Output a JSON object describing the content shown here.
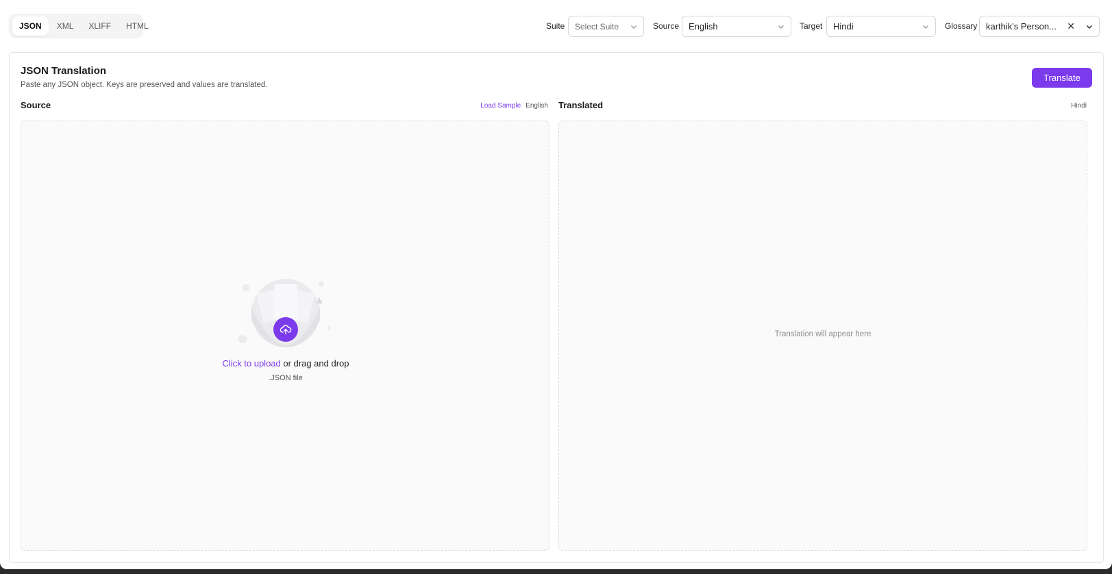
{
  "format_tabs": [
    {
      "label": "JSON",
      "active": true
    },
    {
      "label": "XML",
      "active": false
    },
    {
      "label": "XLIFF",
      "active": false
    },
    {
      "label": "HTML",
      "active": false
    }
  ],
  "controls": {
    "suite": {
      "label": "Suite",
      "placeholder": "Select Suite"
    },
    "source": {
      "label": "Source",
      "value": "English"
    },
    "target": {
      "label": "Target",
      "value": "Hindi"
    },
    "glossary": {
      "label": "Glossary",
      "value": "karthik's Person...",
      "clear_icon": "close-icon"
    }
  },
  "card": {
    "title": "JSON Translation",
    "subtitle": "Paste any JSON object. Keys are preserved and values are translated.",
    "translate_label": "Translate"
  },
  "source_pane": {
    "title": "Source",
    "load_sample": "Load Sample",
    "language": "English",
    "upload_link": "Click to upload",
    "upload_rest": " or drag and drop",
    "upload_hint": ".JSON file"
  },
  "translated_pane": {
    "title": "Translated",
    "language": "Hindi",
    "placeholder": "Translation will appear here"
  },
  "colors": {
    "accent": "#7c3aed"
  }
}
